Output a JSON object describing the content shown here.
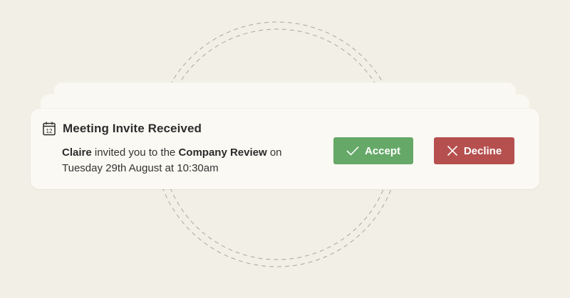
{
  "colors": {
    "background": "#f2f0e6",
    "card": "#faf9f3",
    "accept": "#66a868",
    "decline": "#b5504f",
    "text": "#2d2d2d"
  },
  "notification": {
    "icon": "calendar-icon",
    "icon_day": "12",
    "title": "Meeting Invite Received",
    "sender": "Claire",
    "text_middle": " invited you to the ",
    "event": "Company Review",
    "text_after": " on",
    "datetime": "Tuesday 29th August at 10:30am"
  },
  "actions": {
    "accept_label": "Accept",
    "accept_icon": "check-icon",
    "decline_label": "Decline",
    "decline_icon": "close-icon"
  }
}
